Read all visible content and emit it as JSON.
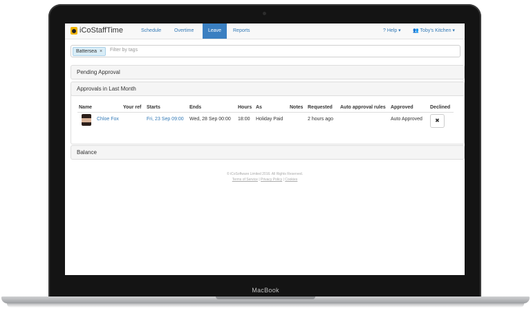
{
  "device": {
    "label": "MacBook"
  },
  "nav": {
    "brand": "iCoStaffTime",
    "items": [
      {
        "label": "Schedule",
        "active": false
      },
      {
        "label": "Overtime",
        "active": false
      },
      {
        "label": "Leave",
        "active": true
      },
      {
        "label": "Reports",
        "active": false
      }
    ],
    "help": "? Help ▾",
    "account": "Toby's Kitchen ▾"
  },
  "filter": {
    "tag": "Battersea",
    "tag_remove": "×",
    "placeholder": "Filter by tags"
  },
  "panels": {
    "pending": "Pending Approval",
    "approvals": "Approvals in Last Month",
    "balance": "Balance"
  },
  "table": {
    "headers": [
      "Name",
      "Your ref",
      "Starts",
      "Ends",
      "Hours",
      "As",
      "Notes",
      "Requested",
      "Auto approval rules",
      "Approved",
      "Declined"
    ],
    "rows": [
      {
        "name": "Chloe Fox",
        "your_ref": "",
        "starts": "Fri, 23 Sep 09:00",
        "ends": "Wed, 28 Sep 00:00",
        "hours": "18:00",
        "as": "Holiday Paid",
        "notes": "",
        "requested": "2 hours ago",
        "auto_rules": "",
        "approved": "Auto Approved",
        "declined_button": "✖"
      }
    ]
  },
  "footer": {
    "copyright": "© iCoSoftware Limited 2016. All Rights Reserved.",
    "links": [
      "Terms of Service",
      "Privacy Policy",
      "Cookies"
    ],
    "separator": "|"
  },
  "colors": {
    "accent": "#3a7fc1",
    "link": "#337ab7",
    "brand_icon": "#f2b600"
  }
}
